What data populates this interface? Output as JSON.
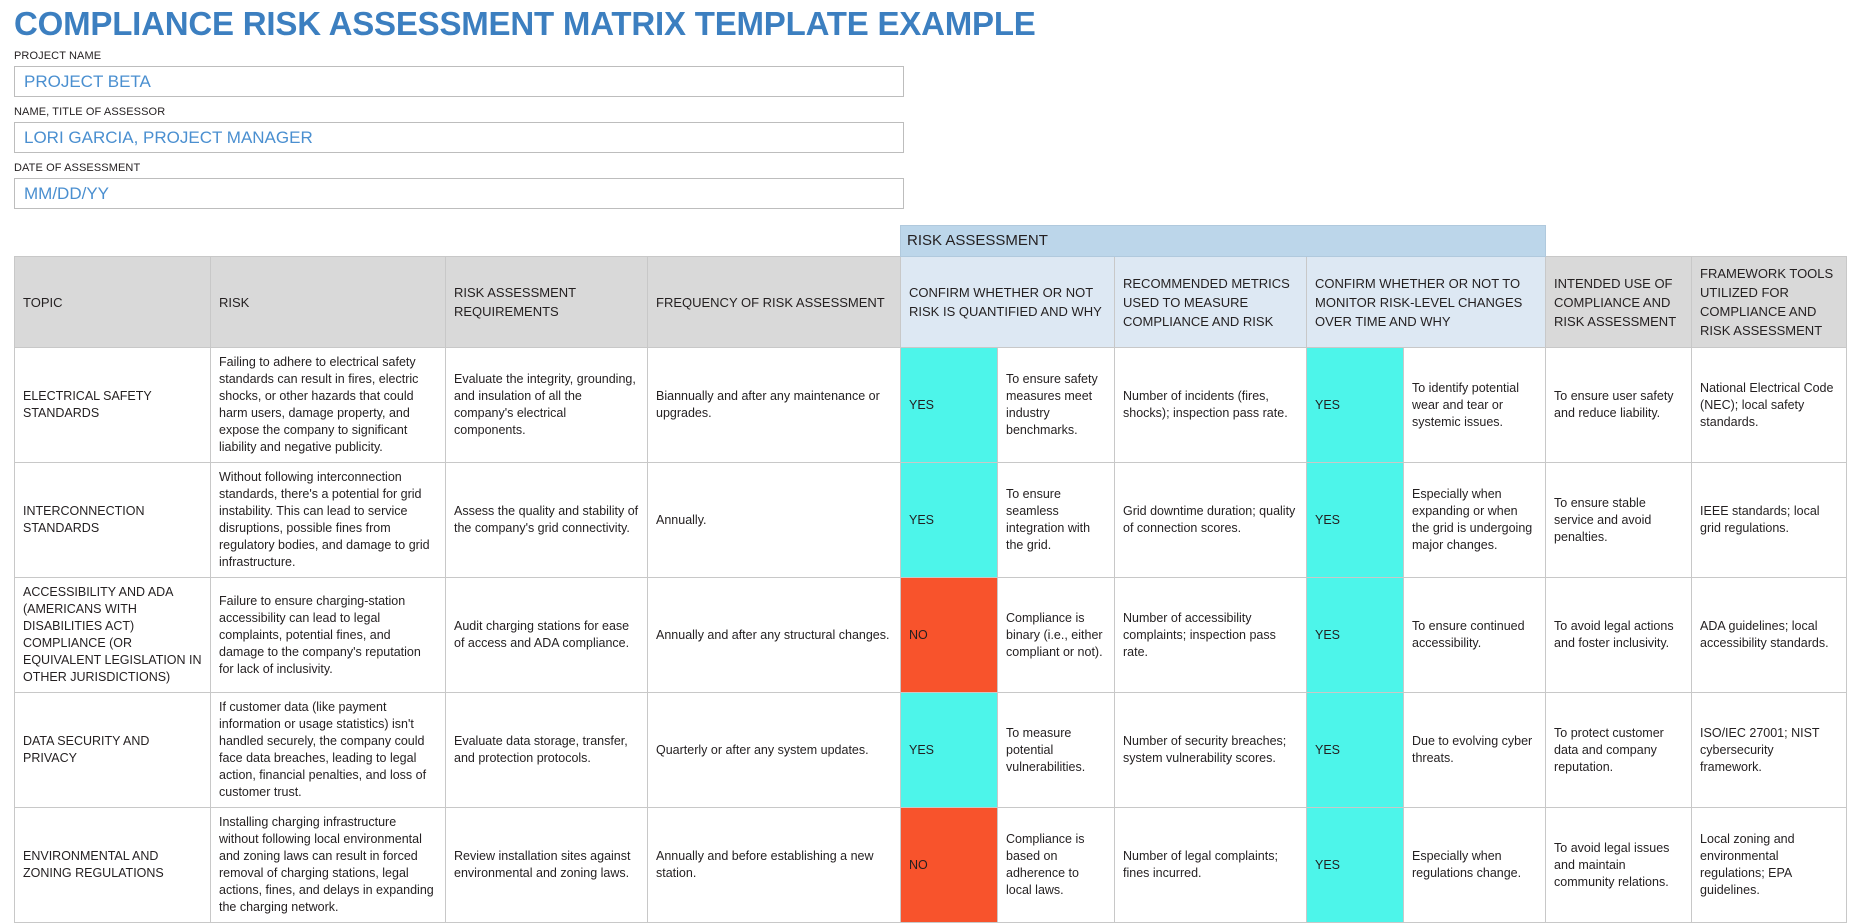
{
  "document": {
    "title": "COMPLIANCE RISK ASSESSMENT MATRIX TEMPLATE EXAMPLE",
    "accent_color": "#3c7fc0",
    "group_header_color": "#bcd6ea",
    "column_header_color": "#d9d9d9",
    "risk_assessment_header_color": "#dde8f3",
    "yes_color": "#4df5ea",
    "no_color": "#f8532c"
  },
  "fields": [
    {
      "label": "PROJECT NAME",
      "value": "PROJECT BETA",
      "placeholder": "PROJECT BETA"
    },
    {
      "label": "NAME, TITLE OF ASSESSOR",
      "value": "LORI GARCIA, PROJECT MANAGER",
      "placeholder": "LORI GARCIA, PROJECT MANAGER"
    },
    {
      "label": "DATE OF ASSESSMENT",
      "value": "MM/DD/YY",
      "placeholder": "MM/DD/YY"
    }
  ],
  "table": {
    "group_header": "RISK ASSESSMENT",
    "columns": [
      "TOPIC",
      "RISK",
      "RISK ASSESSMENT REQUIREMENTS",
      "FREQUENCY OF RISK ASSESSMENT",
      "CONFIRM WHETHER OR NOT RISK IS QUANTIFIED AND WHY",
      "RECOMMENDED METRICS USED TO MEASURE COMPLIANCE AND RISK",
      "CONFIRM WHETHER OR NOT TO MONITOR RISK-LEVEL CHANGES OVER TIME AND WHY",
      "INTENDED USE OF COMPLIANCE AND RISK ASSESSMENT",
      "FRAMEWORK TOOLS UTILIZED FOR COMPLIANCE AND RISK ASSESSMENT"
    ],
    "rows": [
      {
        "topic": "ELECTRICAL SAFETY STANDARDS",
        "risk": "Failing to adhere to electrical safety standards can result in fires, electric shocks, or other hazards that could harm users, damage property, and expose the company to significant liability and negative publicity.",
        "requirements": "Evaluate the integrity, grounding, and insulation of all the company's electrical components.",
        "frequency": "Biannually and after any maintenance or upgrades.",
        "quantified": "YES",
        "quantified_why": "To ensure safety measures meet industry benchmarks.",
        "metrics": "Number of incidents (fires, shocks); inspection pass rate.",
        "monitor": "YES",
        "monitor_why": "To identify potential wear and tear or systemic issues.",
        "intended_use": "To ensure user safety and reduce liability.",
        "framework_tools": "National Electrical Code (NEC); local safety standards."
      },
      {
        "topic": "INTERCONNECTION STANDARDS",
        "risk": "Without following interconnection standards, there's a potential for grid instability. This can lead to service disruptions, possible fines from regulatory bodies, and damage to grid infrastructure.",
        "requirements": "Assess the quality and stability of the company's grid connectivity.",
        "frequency": "Annually.",
        "quantified": "YES",
        "quantified_why": "To ensure seamless integration with the grid.",
        "metrics": "Grid downtime duration; quality of connection scores.",
        "monitor": "YES",
        "monitor_why": "Especially when expanding or when the grid is undergoing major changes.",
        "intended_use": "To ensure stable service and avoid penalties.",
        "framework_tools": "IEEE standards; local grid regulations."
      },
      {
        "topic": "ACCESSIBILITY AND ADA (AMERICANS WITH DISABILITIES ACT) COMPLIANCE (OR EQUIVALENT LEGISLATION IN OTHER JURISDICTIONS)",
        "risk": "Failure to ensure charging-station accessibility can lead to legal complaints, potential fines, and damage to the company's reputation for lack of inclusivity.",
        "requirements": "Audit charging stations for ease of access and ADA compliance.",
        "frequency": "Annually and after any structural changes.",
        "quantified": "NO",
        "quantified_why": "Compliance is binary (i.e., either compliant or not).",
        "metrics": "Number of accessibility complaints; inspection pass rate.",
        "monitor": "YES",
        "monitor_why": "To ensure continued accessibility.",
        "intended_use": "To avoid legal actions and foster inclusivity.",
        "framework_tools": "ADA guidelines; local accessibility standards."
      },
      {
        "topic": "DATA SECURITY AND PRIVACY",
        "risk": "If customer data (like payment information or usage statistics) isn't handled securely, the company could face data breaches, leading to legal action, financial penalties, and loss of customer trust.",
        "requirements": "Evaluate data storage, transfer, and protection protocols.",
        "frequency": "Quarterly or after any system updates.",
        "quantified": "YES",
        "quantified_why": "To measure potential vulnerabilities.",
        "metrics": "Number of security breaches; system vulnerability scores.",
        "monitor": "YES",
        "monitor_why": "Due to evolving cyber threats.",
        "intended_use": "To protect customer data and company reputation.",
        "framework_tools": "ISO/IEC 27001; NIST cybersecurity framework."
      },
      {
        "topic": "ENVIRONMENTAL AND ZONING REGULATIONS",
        "risk": "Installing charging infrastructure without following local environmental and zoning laws can result in forced removal of charging stations, legal actions, fines, and delays in expanding the charging network.",
        "requirements": "Review installation sites against environmental and zoning laws.",
        "frequency": "Annually and before establishing a new station.",
        "quantified": "NO",
        "quantified_why": "Compliance is based on adherence to local laws.",
        "metrics": "Number of legal complaints; fines incurred.",
        "monitor": "YES",
        "monitor_why": "Especially when regulations change.",
        "intended_use": "To avoid legal issues and maintain community relations.",
        "framework_tools": "Local zoning and environmental regulations; EPA guidelines."
      }
    ]
  }
}
